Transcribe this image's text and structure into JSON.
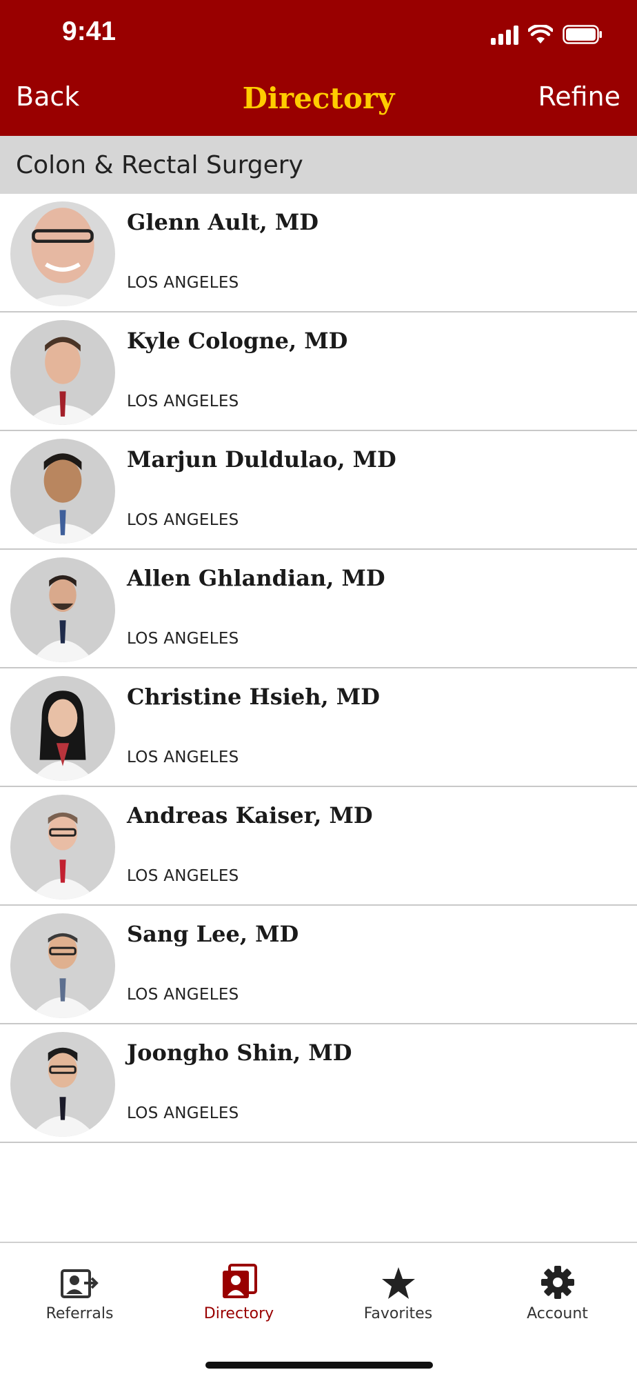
{
  "status_bar": {
    "time": "9:41"
  },
  "nav": {
    "back_label": "Back",
    "title": "Directory",
    "refine_label": "Refine"
  },
  "section": {
    "title": "Colon & Rectal Surgery"
  },
  "doctors": [
    {
      "name": "Glenn Ault, MD",
      "location": "LOS ANGELES"
    },
    {
      "name": "Kyle Cologne, MD",
      "location": "LOS ANGELES"
    },
    {
      "name": "Marjun Duldulao, MD",
      "location": "LOS ANGELES"
    },
    {
      "name": "Allen Ghlandian, MD",
      "location": "LOS ANGELES"
    },
    {
      "name": "Christine Hsieh, MD",
      "location": "LOS ANGELES"
    },
    {
      "name": "Andreas Kaiser, MD",
      "location": "LOS ANGELES"
    },
    {
      "name": "Sang Lee, MD",
      "location": "LOS ANGELES"
    },
    {
      "name": "Joongho Shin, MD",
      "location": "LOS ANGELES"
    }
  ],
  "tabbar": {
    "tabs": [
      {
        "label": "Referrals",
        "icon": "referral-icon"
      },
      {
        "label": "Directory",
        "icon": "directory-icon",
        "active": true
      },
      {
        "label": "Favorites",
        "icon": "star-icon"
      },
      {
        "label": "Account",
        "icon": "gear-icon"
      }
    ]
  },
  "colors": {
    "brand_red": "#990000",
    "title_gold": "#FFCC00",
    "section_gray": "#D6D6D6"
  }
}
